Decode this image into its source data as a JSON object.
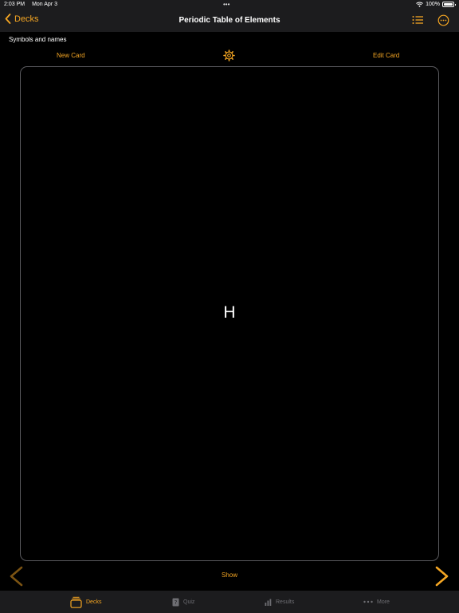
{
  "status_bar": {
    "time": "2:03 PM",
    "date": "Mon Apr 3",
    "battery": "100%"
  },
  "nav": {
    "back_label": "Decks",
    "title": "Periodic Table of Elements"
  },
  "deck": {
    "subtitle": "Symbols and names"
  },
  "toolbar": {
    "new_card": "New Card",
    "edit_card": "Edit Card"
  },
  "card": {
    "front_text": "H"
  },
  "controls": {
    "show_label": "Show"
  },
  "tabs": [
    {
      "label": "Decks",
      "icon": "decks-icon",
      "active": true
    },
    {
      "label": "Quiz",
      "icon": "quiz-icon",
      "active": false
    },
    {
      "label": "Results",
      "icon": "results-icon",
      "active": false
    },
    {
      "label": "More",
      "icon": "more-dots-icon",
      "active": false
    }
  ],
  "colors": {
    "accent": "#f5a623",
    "background": "#000000",
    "bar": "#1c1c1e",
    "inactive": "#6e6e73"
  }
}
